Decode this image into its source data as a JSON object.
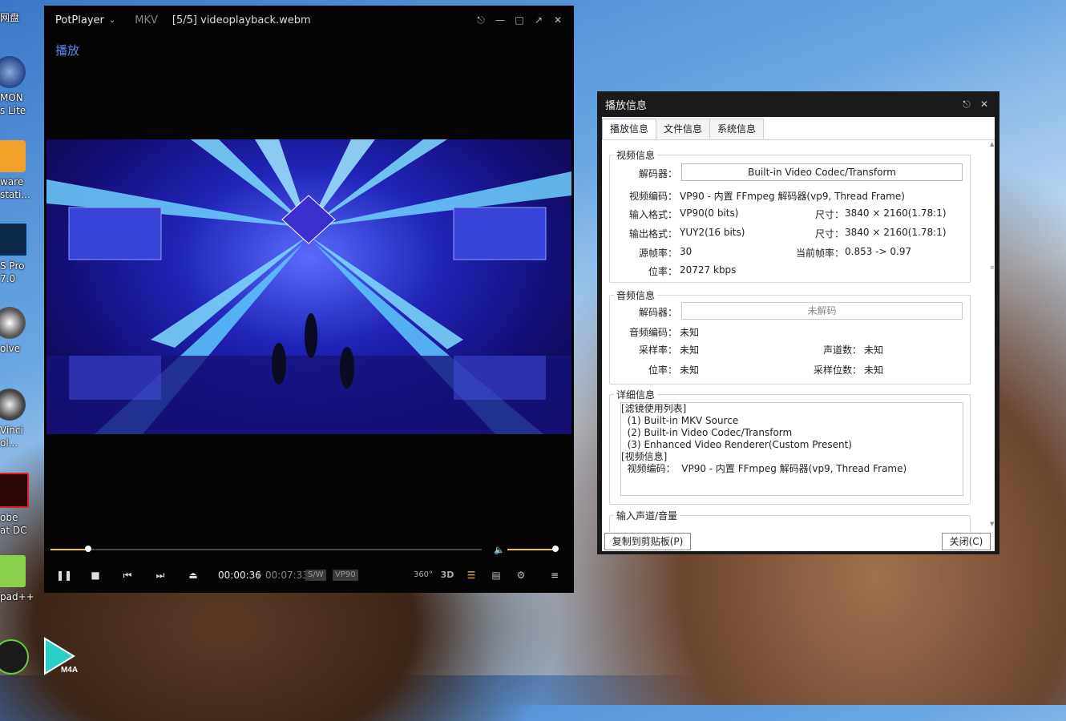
{
  "desktop": {
    "icons": [
      {
        "label": "网盘"
      },
      {
        "label": "MON"
      },
      {
        "label": "s Lite"
      },
      {
        "label": "ware"
      },
      {
        "label": "stati..."
      },
      {
        "label": "S Pro"
      },
      {
        "label": "7.0"
      },
      {
        "label": "olve"
      },
      {
        "label": "Vinci"
      },
      {
        "label": "ol..."
      },
      {
        "label": "obe"
      },
      {
        "label": "at DC"
      },
      {
        "label": "pad++"
      }
    ],
    "m4a_label": "M4A"
  },
  "player": {
    "brand": "PotPlayer",
    "format": "MKV",
    "filename": "[5/5] videoplayback.webm",
    "menu_label": "播放",
    "seek_progress": 0.087,
    "volume_level": 0.97,
    "time_current": "00:00:36",
    "time_separator": "/",
    "time_total": "00:07:33",
    "tag_sw": "S/W",
    "tag_codec": "VP90",
    "btn_360": "360°",
    "btn_3d": "3D"
  },
  "dialog": {
    "title": "播放信息",
    "tabs": [
      "播放信息",
      "文件信息",
      "系统信息"
    ],
    "video": {
      "group_title": "视频信息",
      "decoder_label": "解码器：",
      "decoder_value": "Built-in Video Codec/Transform",
      "codec_label": "视频编码：",
      "codec_value": "VP90 - 内置 FFmpeg 解码器(vp9, Thread Frame)",
      "input_label": "输入格式：",
      "input_value": "VP90(0 bits)",
      "input_size_label": "尺寸：",
      "input_size_value": "3840 × 2160(1.78:1)",
      "output_label": "输出格式：",
      "output_value": "YUY2(16 bits)",
      "output_size_label": "尺寸：",
      "output_size_value": "3840 × 2160(1.78:1)",
      "src_fps_label": "源帧率：",
      "src_fps_value": "30",
      "cur_fps_label": "当前帧率：",
      "cur_fps_value": "0.853 -> 0.97",
      "bitrate_label": "位率：",
      "bitrate_value": "20727 kbps"
    },
    "audio": {
      "group_title": "音频信息",
      "decoder_label": "解码器：",
      "decoder_value": "未解码",
      "codec_label": "音频编码：",
      "codec_value": "未知",
      "samplerate_label": "采样率：",
      "samplerate_value": "未知",
      "channels_label": "声道数：",
      "channels_value": "未知",
      "bitrate_label": "位率：",
      "bitrate_value": "未知",
      "bits_label": "采样位数：",
      "bits_value": "未知"
    },
    "details": {
      "group_title": "详细信息",
      "lines": [
        "[滤镜使用列表]",
        "  (1) Built-in MKV Source",
        "  (2) Built-in Video Codec/Transform",
        "  (3) Enhanced Video Renderer(Custom Present)",
        "",
        "[视频信息]",
        "  视频编码：  VP90 - 内置 FFmpeg 解码器(vp9, Thread Frame)"
      ]
    },
    "input_channel_title": "输入声道/音量",
    "copy_button": "复制到剪贴板(P)",
    "close_button": "关闭(C)"
  }
}
